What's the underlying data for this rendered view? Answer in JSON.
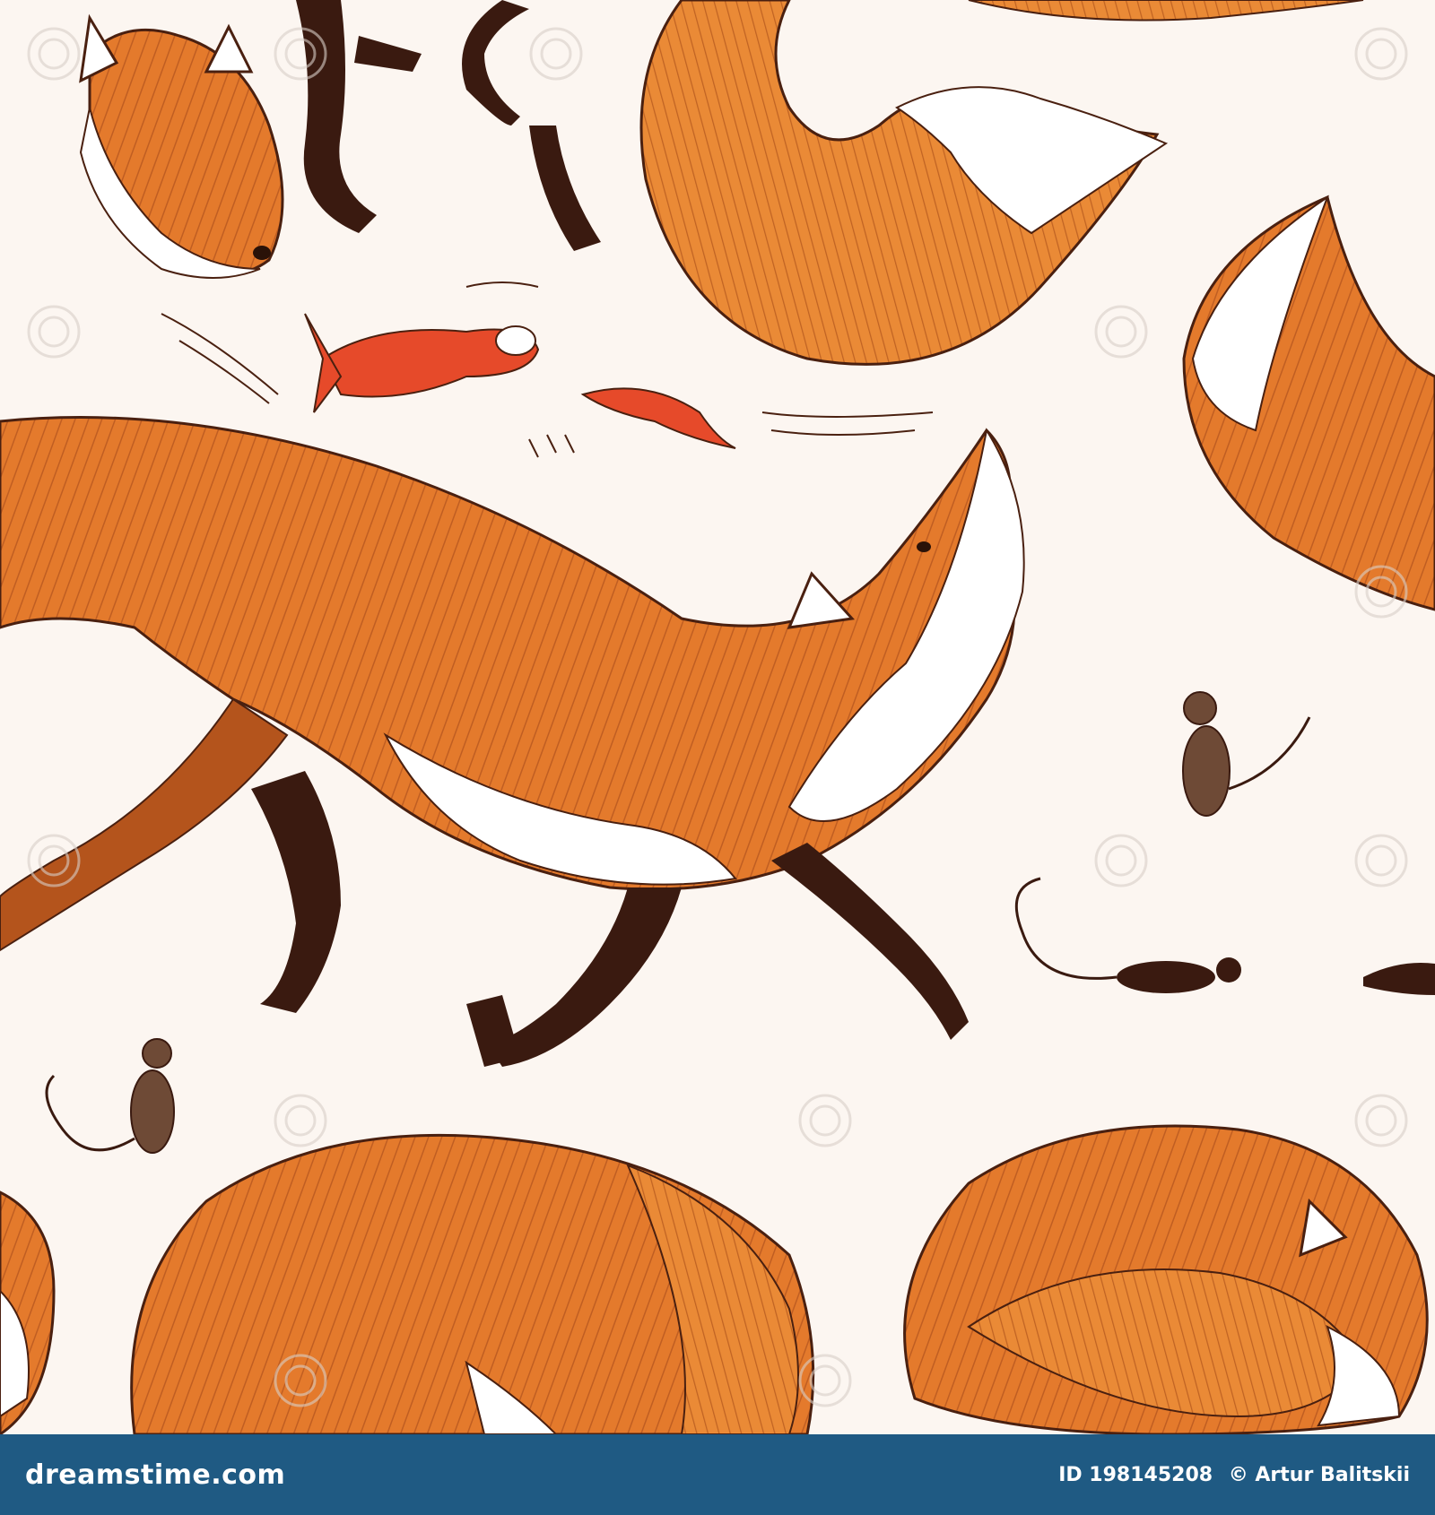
{
  "image": {
    "background_color": "#fcf6f1",
    "fox_fur_color": "#e0782c",
    "fox_shadow_color": "#a84a1a",
    "leg_color": "#3a1a10",
    "white_fur_color": "#ffffff",
    "fish_color": "#e64a2a",
    "mouse_color": "#6e4a36"
  },
  "footer": {
    "brand": "dreamstime.com",
    "id_text": "ID 198145208",
    "author_text": "© Artur Balitskii",
    "bar_color": "#1f5a83"
  }
}
